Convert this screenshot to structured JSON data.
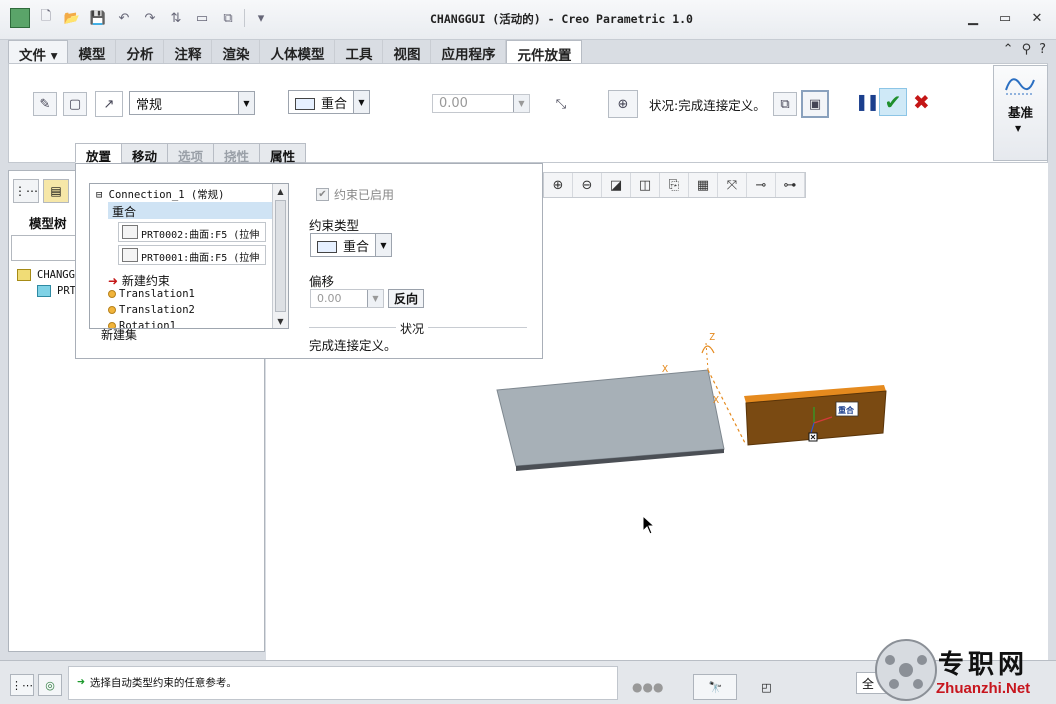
{
  "app": {
    "title": "CHANGGUI (活动的) - Creo Parametric 1.0"
  },
  "ribbon_tabs": [
    "文件",
    "模型",
    "分析",
    "注释",
    "渲染",
    "人体模型",
    "工具",
    "视图",
    "应用程序",
    "元件放置"
  ],
  "active_tab": "元件放置",
  "dashboard": {
    "set_type": "常规",
    "constraint_type": "重合",
    "offset_value": "0.00",
    "status": "状况:完成连接定义。",
    "datum_label": "基准"
  },
  "slide_tabs": [
    "放置",
    "移动",
    "选项",
    "挠性",
    "属性"
  ],
  "placement_panel": {
    "connection": "Connection_1 (常规)",
    "selected_constraint": "重合",
    "references": [
      "PRT0002:曲面:F5 (拉伸",
      "PRT0001:曲面:F5 (拉伸"
    ],
    "new_constraint": "新建约束",
    "sets": [
      "Translation1",
      "Translation2",
      "Rotation1"
    ],
    "new_set": "新建集",
    "enabled_label": "约束已启用",
    "constraint_type_label": "约束类型",
    "constraint_type_value": "重合",
    "offset_label": "偏移",
    "offset_value": "0.00",
    "flip_label": "反向",
    "status_title": "状况",
    "status_message": "完成连接定义。"
  },
  "model_tree": {
    "header": "模型树",
    "root": "CHANGGU",
    "child": "PRT"
  },
  "viewport": {
    "axis_labels": [
      "Z",
      "X",
      "X"
    ],
    "tag": "重合"
  },
  "statusbar": {
    "message": "选择自动类型约束的任意参考。",
    "filter": "全"
  },
  "watermark": {
    "cn": "专职网",
    "en": "Zhuanzhi.Net"
  },
  "colors": {
    "accent_blue": "#1b3f8d",
    "ok_green": "#1f8f2c",
    "cancel_red": "#c41616",
    "plate_gray": "#a7b0b7",
    "part_brown": "#7a4a12",
    "part_orange": "#e58a1e"
  }
}
